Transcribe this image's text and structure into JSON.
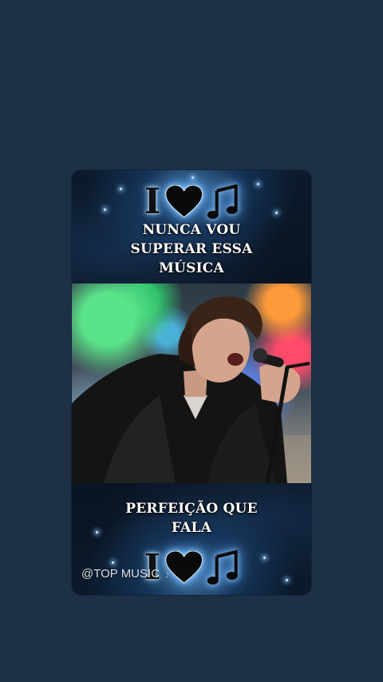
{
  "post": {
    "top_caption_lines": [
      "NUNCA VOU",
      "SUPERAR ESSA",
      "MÚSICA"
    ],
    "bottom_caption_lines": [
      "PERFEIÇÃO QUE",
      "FALA"
    ],
    "logo_letter": "I",
    "logo_icons": [
      "heart-icon",
      "music-note-icon"
    ],
    "watermark": "@TOP MUSIC",
    "watermark_icon": "tiktok-icon",
    "photo_subject": "singer-photo"
  },
  "colors": {
    "page_background": "#1d3048",
    "caption_text": "#ffffff",
    "glow": "#7fc1ff"
  }
}
